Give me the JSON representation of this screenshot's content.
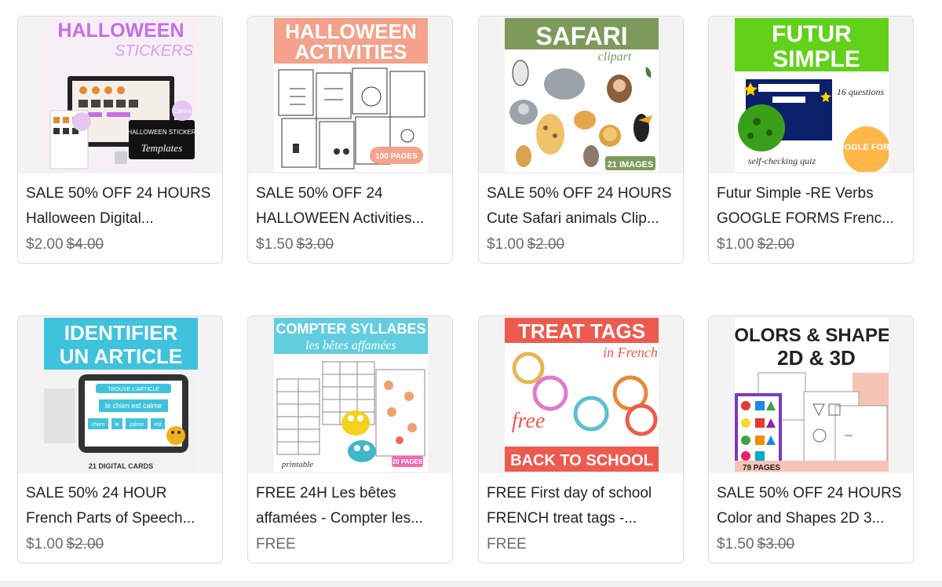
{
  "products": [
    {
      "title_line1": "SALE 50% OFF 24 HOURS",
      "title_line2": "Halloween Digital...",
      "price": "$2.00",
      "original_price": "$4.00",
      "thumb": {
        "heading1": "HALLOWEEN",
        "heading2": "STICKERS",
        "caption": "HALLOWEEN STICKER",
        "caption2": "Templates",
        "badge": "Canva",
        "bg": "#f6f0f6",
        "accent": "#c86ee6"
      }
    },
    {
      "title_line1": "SALE 50% OFF 24",
      "title_line2": "HALLOWEEN Activities...",
      "price": "$1.50",
      "original_price": "$3.00",
      "thumb": {
        "heading1": "HALLOWEEN",
        "heading2": "ACTIVITIES",
        "badge": "100 PAGES",
        "bg": "#ffffff",
        "accent": "#f4a28c"
      }
    },
    {
      "title_line1": "SALE 50% OFF 24 HOURS",
      "title_line2": "Cute Safari animals Clip...",
      "price": "$1.00",
      "original_price": "$2.00",
      "thumb": {
        "heading1": "SAFARI",
        "heading2": "clipart",
        "badge": "21 IMAGES",
        "bg": "#ffffff",
        "accent": "#7d9a5c"
      }
    },
    {
      "title_line1": "Futur Simple -RE Verbs",
      "title_line2": "GOOGLE FORMS Frenc...",
      "price": "$1.00",
      "original_price": "$2.00",
      "thumb": {
        "heading1": "FUTUR",
        "heading2": "SIMPLE",
        "note": "16 questions",
        "caption": "self-checking quiz",
        "badge": "GOOGLE FORMS",
        "bg": "#ffffff",
        "accent": "#62d11a"
      }
    },
    {
      "title_line1": "SALE 50% 24 HOUR",
      "title_line2": "French Parts of Speech...",
      "price": "$1.00",
      "original_price": "$2.00",
      "thumb": {
        "heading1": "IDENTIFIER",
        "heading2": "UN ARTICLE",
        "screen_title": "TROUVE L'ARTICLE",
        "sentence": "le chien est calme",
        "words": [
          "chien",
          "le",
          "calme",
          "est"
        ],
        "caption": "21 DIGITAL CARDS",
        "bg": "#ffffff",
        "accent": "#3fc3dc"
      }
    },
    {
      "title_line1": "FREE 24H Les bêtes",
      "title_line2": "affamées - Compter les...",
      "price": "FREE",
      "original_price": "",
      "thumb": {
        "heading1": "COMPTER SYLLABES",
        "heading2": "les bêtes affamées",
        "caption": "printable",
        "badge": "20 PAGES",
        "bg": "#ffffff",
        "accent": "#63cde0"
      }
    },
    {
      "title_line1": "FREE First day of school",
      "title_line2": "FRENCH treat tags -...",
      "price": "FREE",
      "original_price": "",
      "thumb": {
        "heading1": "TREAT TAGS",
        "heading2": "in French",
        "script": "free",
        "footer": "BACK TO SCHOOL",
        "bg": "#ffffff",
        "accent": "#ef5a4e"
      }
    },
    {
      "title_line1": "SALE 50% OFF 24 HOURS",
      "title_line2": "Color and Shapes 2D 3...",
      "price": "$1.50",
      "original_price": "$3.00",
      "thumb": {
        "heading1": "COLORS & SHAPES",
        "heading2": "2D & 3D",
        "badge": "79 PAGES",
        "bg": "#ffffff",
        "accent": "#f5a891"
      }
    }
  ]
}
